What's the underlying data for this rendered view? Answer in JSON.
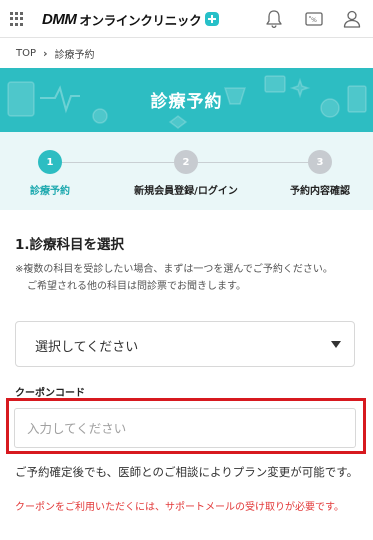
{
  "header": {
    "logo_brand": "DMM",
    "logo_service": "オンラインクリニック",
    "icons": [
      "grid-menu-icon",
      "bell-icon",
      "coupon-ticket-icon",
      "user-icon"
    ],
    "accent_color": "#2dbdc2"
  },
  "breadcrumb": {
    "items": [
      "TOP",
      "診療予約"
    ]
  },
  "banner": {
    "title": "診療予約",
    "background_color": "#2dbdc2"
  },
  "stepper": {
    "steps": [
      {
        "number": "1",
        "label": "診療予約",
        "state": "active"
      },
      {
        "number": "2",
        "label": "新規会員登録/ログイン",
        "state": "inactive"
      },
      {
        "number": "3",
        "label": "予約内容確認",
        "state": "inactive"
      }
    ]
  },
  "section": {
    "title": "1.診療科目を選択",
    "note_line1": "※複数の科目を受診したい場合、まずは一つを選んでご予約ください。",
    "note_line2": "ご希望される他の科目は問診票でお聞きします。",
    "select_value": "選択してください"
  },
  "coupon": {
    "label": "クーポンコード",
    "placeholder": "入力してください",
    "value": "",
    "highlight_color": "#d7191f"
  },
  "info": {
    "text": "ご予約確定後でも、医師とのご相談によりプラン変更が可能です。",
    "warning": "クーポンをご利用いただくには、サポートメールの受け取りが必要です。",
    "warning_color": "#e23838"
  }
}
